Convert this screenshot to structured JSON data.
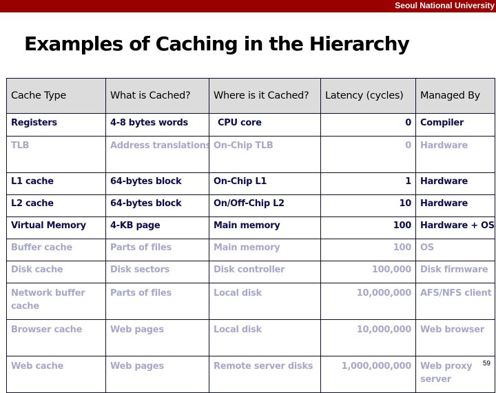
{
  "header": {
    "organization": "Seoul National University"
  },
  "slide": {
    "title": "Examples of Caching in the Hierarchy",
    "page_number": "59"
  },
  "table": {
    "columns": [
      "Cache Type",
      "What is Cached?",
      "Where is it Cached?",
      "Latency (cycles)",
      "Managed By"
    ],
    "rows": [
      {
        "cache_type": "Registers",
        "what": "4-8 bytes words",
        "where": "CPU core",
        "latency": "0",
        "managed_by": "Compiler",
        "emphasis": "dark"
      },
      {
        "cache_type": "TLB",
        "what": "Address translations",
        "where": "On-Chip TLB",
        "latency": "0",
        "managed_by": "Hardware",
        "emphasis": "light"
      },
      {
        "cache_type": "L1 cache",
        "what": "64-bytes block",
        "where": "On-Chip L1",
        "latency": "1",
        "managed_by": "Hardware",
        "emphasis": "dark"
      },
      {
        "cache_type": "L2 cache",
        "what": "64-bytes block",
        "where": "On/Off-Chip L2",
        "latency": "10",
        "managed_by": "Hardware",
        "emphasis": "dark"
      },
      {
        "cache_type": "Virtual Memory",
        "what": "4-KB page",
        "where": "Main memory",
        "latency": "100",
        "managed_by": "Hardware + OS",
        "emphasis": "dark"
      },
      {
        "cache_type": "Buffer cache",
        "what": "Parts of files",
        "where": "Main memory",
        "latency": "100",
        "managed_by": "OS",
        "emphasis": "light"
      },
      {
        "cache_type": "Disk cache",
        "what": "Disk sectors",
        "where": "Disk controller",
        "latency": "100,000",
        "managed_by": "Disk firmware",
        "emphasis": "light"
      },
      {
        "cache_type": "Network buffer cache",
        "what": "Parts of files",
        "where": "Local disk",
        "latency": "10,000,000",
        "managed_by": "AFS/NFS client",
        "emphasis": "light"
      },
      {
        "cache_type": "Browser cache",
        "what": "Web pages",
        "where": "Local disk",
        "latency": "10,000,000",
        "managed_by": "Web browser",
        "emphasis": "light"
      },
      {
        "cache_type": "Web cache",
        "what": "Web pages",
        "where": "Remote server disks",
        "latency": "1,000,000,000",
        "managed_by": "Web proxy server",
        "emphasis": "light"
      }
    ]
  }
}
